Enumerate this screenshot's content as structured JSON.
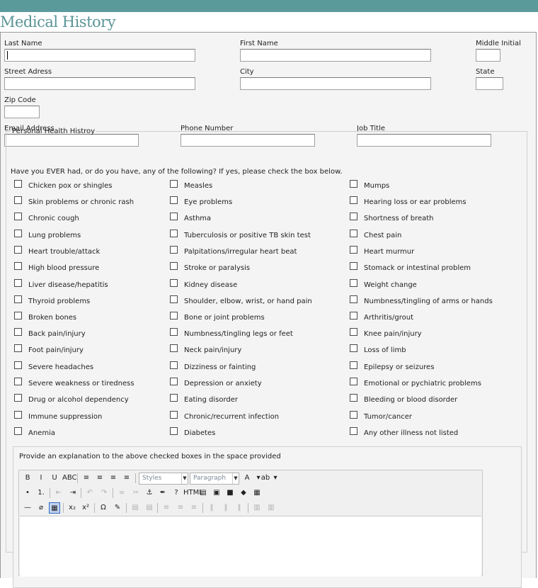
{
  "page": {
    "title": "Medical History"
  },
  "fields": {
    "last_name": {
      "label": "Last Name",
      "value": ""
    },
    "first_name": {
      "label": "First Name",
      "value": ""
    },
    "middle_initial": {
      "label": "Middle Initial",
      "value": ""
    },
    "street": {
      "label": "Street Adress",
      "value": ""
    },
    "city": {
      "label": "City",
      "value": ""
    },
    "state": {
      "label": "State",
      "value": ""
    },
    "zip": {
      "label": "Zip Code",
      "value": ""
    },
    "email": {
      "label": "Email Address",
      "value": ""
    },
    "phone": {
      "label": "Phone Number",
      "value": ""
    },
    "job_title": {
      "label": "Job Title",
      "value": ""
    }
  },
  "health": {
    "legend": "Personal Health Histroy",
    "instruction": "Have you EVER had, or do you have, any of the following? If yes, please check the box below.",
    "conditions": [
      [
        "Chicken pox or shingles",
        "Measles",
        "Mumps"
      ],
      [
        "Skin problems or chronic rash",
        "Eye problems",
        "Hearing loss or ear problems"
      ],
      [
        "Chronic cough",
        "Asthma",
        "Shortness of breath"
      ],
      [
        "Lung problems",
        "Tuberculosis or positive TB skin test",
        "Chest pain"
      ],
      [
        "Heart trouble/attack",
        "Palpitations/irregular heart beat",
        "Heart murmur"
      ],
      [
        "High blood pressure",
        "Stroke or paralysis",
        "Stomack or intestinal problem"
      ],
      [
        "Liver disease/hepatitis",
        "Kidney disease",
        "Weight change"
      ],
      [
        "Thyroid problems",
        "Shoulder, elbow, wrist, or hand pain",
        "Numbness/tingling of arms or hands"
      ],
      [
        "Broken bones",
        "Bone or joint problems",
        "Arthritis/grout"
      ],
      [
        "Back pain/injury",
        "Numbness/tingling legs or feet",
        "Knee pain/injury"
      ],
      [
        "Foot pain/injury",
        "Neck pain/injury",
        "Loss of limb"
      ],
      [
        "Severe headaches",
        "Dizziness or fainting",
        "Epilepsy or seizures"
      ],
      [
        "Severe weakness or tiredness",
        "Depression or anxiety",
        "Emotional or pychiatric problems"
      ],
      [
        "Drug or alcohol dependency",
        "Eating disorder",
        "Bleeding or blood disorder"
      ],
      [
        "Immune suppression",
        "Chronic/recurrent infection",
        "Tumor/cancer"
      ],
      [
        "Anemia",
        "Diabetes",
        "Any other illness not listed"
      ]
    ]
  },
  "explanation": {
    "label": "Provide an explanation to the above checked boxes in the space provided",
    "styles_combo": "Styles",
    "format_combo": "Paragraph",
    "value": ""
  },
  "toolbar_icons": {
    "row1": [
      "bold",
      "italic",
      "underline",
      "strikethrough",
      "align-left",
      "align-center",
      "align-right",
      "align-justify",
      "text-color",
      "background-color"
    ],
    "row2": [
      "bullet-list",
      "numbered-list",
      "outdent",
      "indent",
      "undo",
      "redo",
      "link",
      "unlink",
      "anchor",
      "cleanup",
      "help",
      "html",
      "paste-text",
      "paste-word",
      "insert-image",
      "insert-media",
      "insert-table"
    ],
    "row3": [
      "horizontal-rule",
      "remove-format",
      "visual-aid",
      "subscript",
      "superscript",
      "special-character",
      "edit-source",
      "row-props",
      "cell-props",
      "insert-row-before",
      "insert-row-after",
      "delete-row",
      "insert-col-before",
      "insert-col-after",
      "delete-col",
      "split-cells",
      "merge-cells"
    ]
  }
}
